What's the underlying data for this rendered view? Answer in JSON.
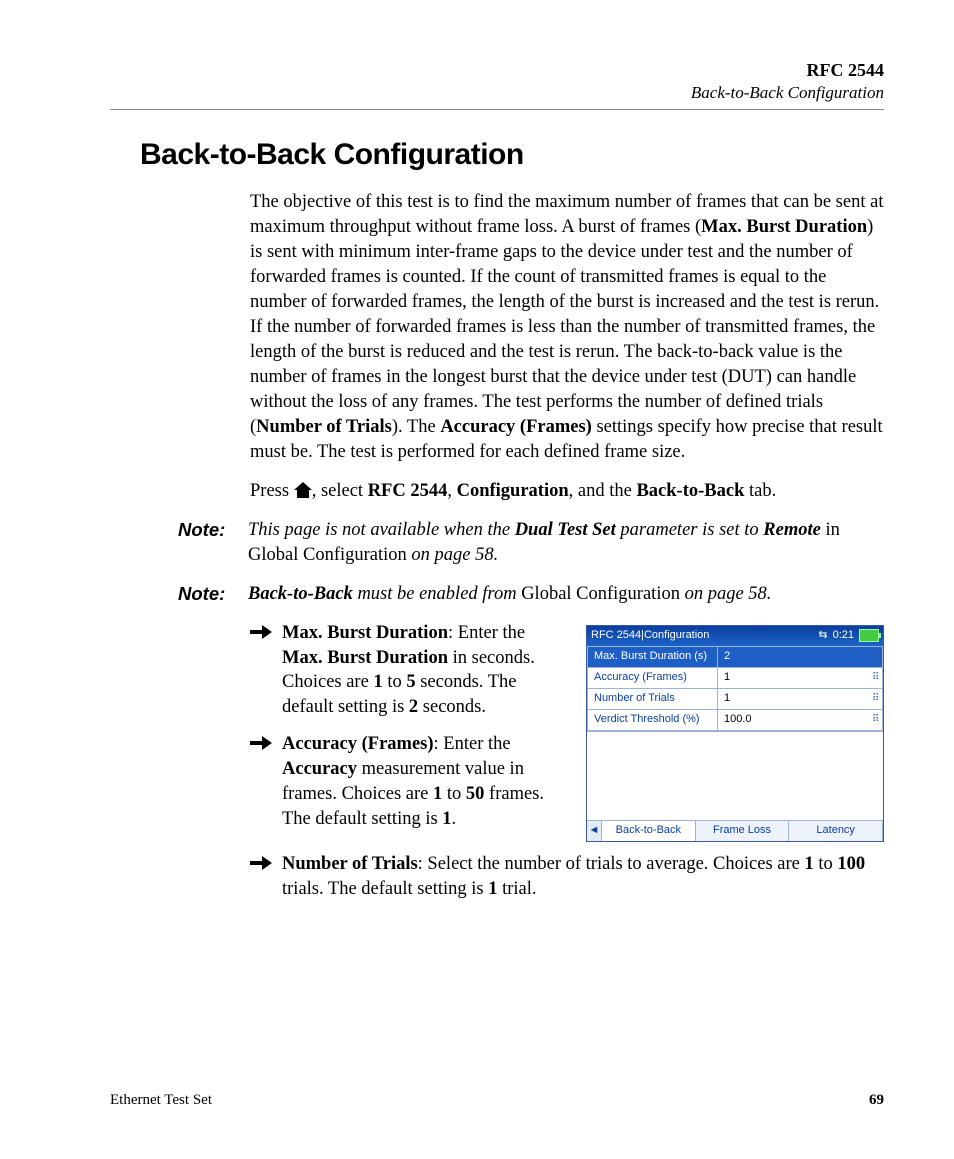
{
  "header": {
    "chapter": "RFC 2544",
    "section_italic": "Back-to-Back Configuration"
  },
  "title": "Back-to-Back Configuration",
  "para1": {
    "pre": "The objective of this test is to find the maximum number of frames that can be sent at maximum throughput without frame loss. A burst of frames (",
    "b1": "Max. Burst Duration",
    "mid1": ") is sent with minimum inter-frame gaps to the device under test and the number of forwarded frames is counted. If the count of transmitted frames is equal to the number of forwarded frames, the length of the burst is increased and the test is rerun.   If the number of forwarded frames is less than the number of transmitted frames, the length of the burst is reduced and the test is rerun. The back-to-back value is the number of frames in the longest burst that the device under test (DUT) can handle without the loss of any frames. The test performs the number of defined trials (",
    "b2": "Number of Trials",
    "mid2": "). The ",
    "b3": "Accuracy (Frames)",
    "post": " settings specify how precise that result must be. The test is performed for each defined frame size."
  },
  "para2": {
    "pre": "Press ",
    "post1": ", select ",
    "b1": "RFC 2544",
    "c1": ", ",
    "b2": "Configuration",
    "c2": ", and the ",
    "b3": "Back-to-Back",
    "post2": " tab."
  },
  "note_label": "Note:",
  "note1": {
    "pre": "This page is not available when the ",
    "b1": "Dual Test Set",
    "mid": " parameter is set to ",
    "b2": "Remote",
    "roman1": " in ",
    "roman_link": "Global Configuration",
    "roman2": " on page 58."
  },
  "note2": {
    "b1": "Back-to-Back",
    "mid": " must be enabled from ",
    "roman_link": "Global Configuration",
    "roman2": " on page 58."
  },
  "bullets": [
    {
      "b_title": "Max. Burst Duration",
      "t1": ": Enter the ",
      "b2": "Max. Burst Duration",
      "t2": " in seconds. Choices are ",
      "b3": "1",
      "t3": " to ",
      "b4": "5",
      "t4": " seconds. The default setting is ",
      "b5": "2",
      "t5": " seconds."
    },
    {
      "b_title": "Accuracy (Frames)",
      "t1": ": Enter the ",
      "b2": "Accuracy",
      "t2": " measurement value in frames. Choices are ",
      "b3": "1",
      "t3": " to ",
      "b4": "50",
      "t4": " frames. The default setting is ",
      "b5": "1",
      "t5": "."
    },
    {
      "b_title": "Number of Trials",
      "t1": ": Select the number of trials to average. Choices are ",
      "b2": "1",
      "t2": " to ",
      "b3": "100",
      "t3": " trials. The default setting is ",
      "b4": "1",
      "t4": " trial.",
      "b5": "",
      "t5": ""
    }
  ],
  "device": {
    "breadcrumb": "RFC 2544|Configuration",
    "time": "0:21",
    "rows": [
      {
        "label": "Max. Burst Duration (s)",
        "value": "2",
        "selected": true
      },
      {
        "label": "Accuracy (Frames)",
        "value": "1",
        "selected": false
      },
      {
        "label": "Number of Trials",
        "value": "1",
        "selected": false
      },
      {
        "label": "Verdict Threshold (%)",
        "value": "100.0",
        "selected": false
      }
    ],
    "tabs": {
      "scroll_left": "◄",
      "items": [
        "Back-to-Back",
        "Frame Loss",
        "Latency"
      ],
      "active_index": 0
    }
  },
  "footer": {
    "product": "Ethernet Test Set",
    "page": "69"
  }
}
